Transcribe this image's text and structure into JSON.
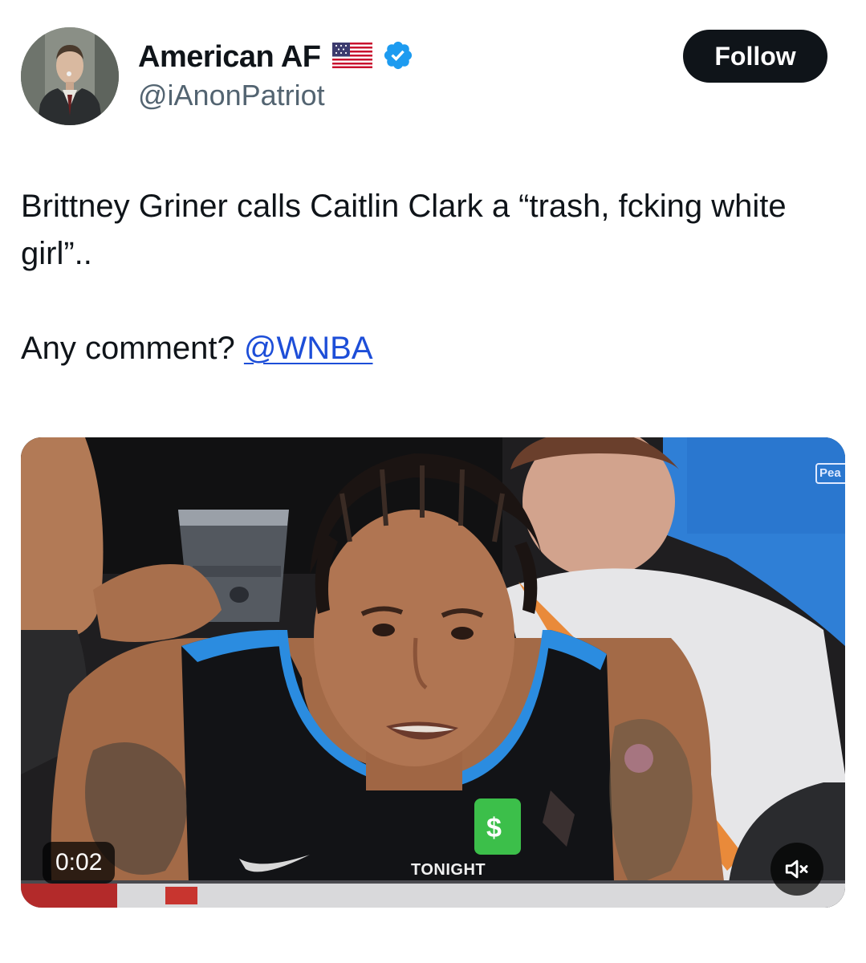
{
  "author": {
    "display_name": "American AF",
    "handle": "@iAnonPatriot",
    "flag_icon": "us-flag-icon",
    "verified_icon": "verified-badge-icon",
    "verified_color": "#1d9bf0"
  },
  "follow_button": {
    "label": "Follow"
  },
  "tweet": {
    "line1": "Brittney Griner calls Caitlin Clark a “trash, fcking white girl”..",
    "line2_prefix": "Any comment? ",
    "mention": "@WNBA"
  },
  "media": {
    "timestamp": "0:02",
    "overlay_text": "TONIGHT",
    "corner_text": "Pea",
    "mute_icon": "speaker-muted-icon"
  },
  "colors": {
    "text": "#0f1419",
    "secondary_text": "#536471",
    "link": "#1d4ed8",
    "button_bg": "#0f1419"
  }
}
